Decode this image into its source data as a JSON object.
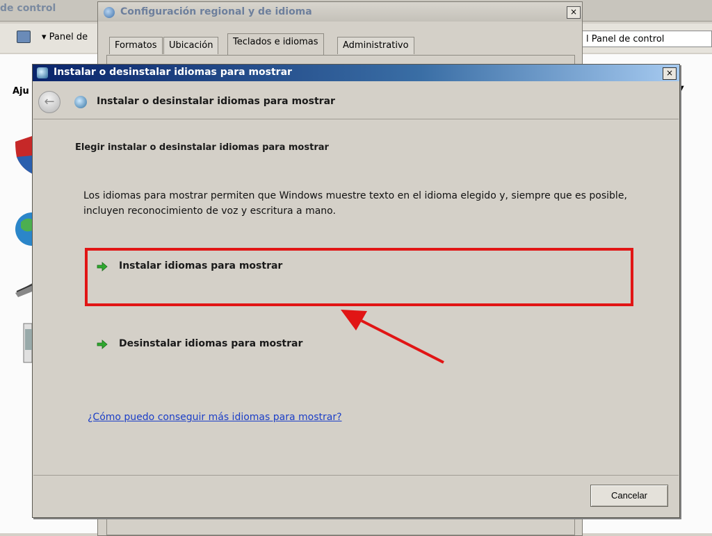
{
  "background_window": {
    "title": "de control",
    "address_left": "▾ Panel de",
    "address_right": "l Panel de control",
    "content_label": "Aju"
  },
  "regional_dialog": {
    "title": "Configuración regional y de idioma",
    "close_label": "×",
    "tabs": [
      {
        "label": "Formatos"
      },
      {
        "label": "Ubicación"
      },
      {
        "label": "Teclados e idiomas"
      },
      {
        "label": "Administrativo"
      }
    ],
    "active_tab": "Teclados e idiomas"
  },
  "main_dialog": {
    "title": "Instalar o desinstalar idiomas para mostrar",
    "close_label": "×",
    "nav_title": "Instalar o desinstalar idiomas para mostrar",
    "heading": "Elegir instalar o desinstalar idiomas para mostrar",
    "description": "Los idiomas para mostrar permiten que Windows muestre texto en el idioma elegido y, siempre que es posible, incluyen reconocimiento de voz y escritura a mano.",
    "tasks": [
      {
        "label": "Instalar idiomas para mostrar"
      },
      {
        "label": "Desinstalar idiomas para mostrar"
      }
    ],
    "help_link": "¿Cómo puedo conseguir más idiomas para mostrar?",
    "cancel_label": "Cancelar"
  },
  "colors": {
    "annotation": "#e11515",
    "task_arrow": "#2fa82f",
    "link": "#1b3ec7"
  }
}
